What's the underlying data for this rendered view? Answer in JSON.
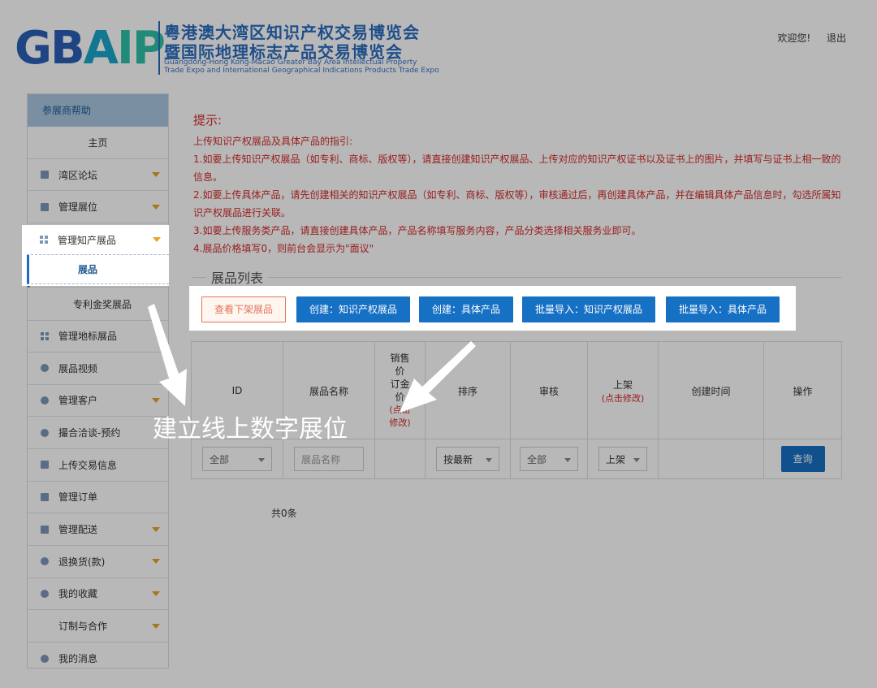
{
  "header": {
    "logo_letters": {
      "g": "G",
      "b": "B",
      "a": "A",
      "ip": "IP"
    },
    "cn_line1": "粤港澳大湾区知识产权交易博览会",
    "cn_line2": "暨国际地理标志产品交易博览会",
    "en_line1": "Guangdong-Hong Kong-Macao Greater Bay Area Intellectual Property",
    "en_line2": "Trade Expo and International Geographical Indications Products Trade Expo",
    "welcome": "欢迎您!",
    "logout": "退出"
  },
  "sidebar": {
    "title": "参展商帮助",
    "items": [
      {
        "label": "主页",
        "icon": "none"
      },
      {
        "label": "湾区论坛",
        "icon": "square-icon",
        "caret": true
      },
      {
        "label": "管理展位",
        "icon": "square-icon",
        "caret": true
      },
      {
        "label": "管理知产展品",
        "icon": "grid-icon",
        "caret": true
      },
      {
        "label": "展品",
        "icon": "none"
      },
      {
        "label": "专利金奖展品",
        "icon": "none"
      },
      {
        "label": "管理地标展品",
        "icon": "grid-icon",
        "caret": true
      },
      {
        "label": "展品视频",
        "icon": "dot-icon"
      },
      {
        "label": "管理客户",
        "icon": "user-icon",
        "caret": true
      },
      {
        "label": "撮合洽谈-预约",
        "icon": "dot-icon"
      },
      {
        "label": "上传交易信息",
        "icon": "file-icon"
      },
      {
        "label": "管理订单",
        "icon": "square-icon"
      },
      {
        "label": "管理配送",
        "icon": "square-icon",
        "caret": true
      },
      {
        "label": "退换货(款)",
        "icon": "dot-icon",
        "caret": true
      },
      {
        "label": "我的收藏",
        "icon": "star-icon",
        "caret": true
      },
      {
        "label": "订制与合作",
        "icon": "none",
        "caret": true
      },
      {
        "label": "我的消息",
        "icon": "dot-icon"
      }
    ]
  },
  "hint": {
    "title": "提示:",
    "lines": [
      "上传知识产权展品及具体产品的指引:",
      "1.如要上传知识产权展品（如专利、商标、版权等），请直接创建知识产权展品、上传对应的知识产权证书以及证书上的图片，并填写与证书上相一致的信息。",
      "2.如要上传具体产品，请先创建相关的知识产权展品（如专利、商标、版权等），审核通过后，再创建具体产品，并在编辑具体产品信息时，勾选所属知识产权展品进行关联。",
      "3.如要上传服务类产品，请直接创建具体产品，产品名称填写服务内容，产品分类选择相关服务业即可。",
      "4.展品价格填写0，则前台会显示为\"面议\""
    ]
  },
  "list": {
    "section_title": "展品列表",
    "buttons": {
      "view_offline": "查看下架展品",
      "create_ip": "创建：知识产权展品",
      "create_product": "创建：具体产品",
      "import_ip": "批量导入：知识产权展品",
      "import_product": "批量导入：具体产品"
    },
    "columns": {
      "id": "ID",
      "name": "展品名称",
      "price_l1": "销售",
      "price_l2": "价",
      "price_l3": "订金",
      "price_l4": "价",
      "price_note1": "(点击",
      "price_note2": "修改)",
      "sort": "排序",
      "audit": "审核",
      "shelf": "上架",
      "shelf_note": "(点击修改)",
      "created": "创建时间",
      "action": "操作"
    },
    "filters": {
      "id_select": "全部",
      "name_placeholder": "展品名称",
      "sort_select": "按最新",
      "audit_select": "全部",
      "shelf_select": "上架",
      "query_button": "查询"
    },
    "total": "共0条"
  },
  "annotation": {
    "text": "建立线上数字展位"
  },
  "colors": {
    "primary": "#1670c4",
    "hint_red": "#d62a2a",
    "caret": "#e8a328",
    "sidebar_title_bg": "#aac6df"
  }
}
